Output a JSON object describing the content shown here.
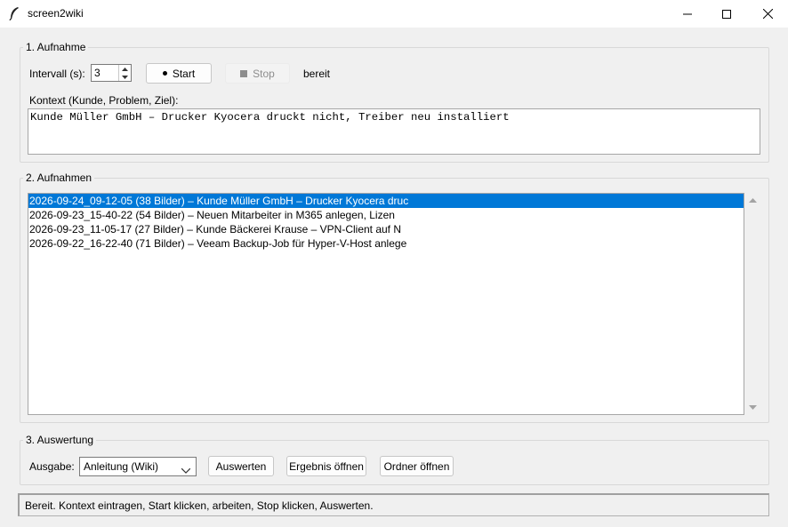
{
  "window": {
    "title": "screen2wiki"
  },
  "section1": {
    "label": "1. Aufnahme",
    "interval_label": "Intervall (s):",
    "interval_value": "3",
    "start_label": "Start",
    "stop_label": "Stop",
    "status": "bereit",
    "context_label": "Kontext (Kunde, Problem, Ziel):",
    "context_value": "Kunde Müller GmbH – Drucker Kyocera druckt nicht, Treiber neu installiert"
  },
  "section2": {
    "label": "2. Aufnahmen",
    "items": [
      "2026-09-24_09-12-05  (38 Bilder) – Kunde Müller GmbH – Drucker Kyocera druc",
      "2026-09-23_15-40-22  (54 Bilder) – Neuen Mitarbeiter in M365 anlegen, Lizen",
      "2026-09-23_11-05-17  (27 Bilder) – Kunde Bäckerei Krause – VPN-Client auf N",
      "2026-09-22_16-22-40  (71 Bilder) – Veeam Backup-Job für Hyper-V-Host anlege"
    ],
    "selected_index": 0
  },
  "section3": {
    "label": "3. Auswertung",
    "output_label": "Ausgabe:",
    "output_value": "Anleitung (Wiki)",
    "evaluate_label": "Auswerten",
    "open_result_label": "Ergebnis öffnen",
    "open_folder_label": "Ordner öffnen"
  },
  "statusbar": {
    "text": "Bereit. Kontext eintragen, Start klicken, arbeiten, Stop klicken, Auswerten."
  },
  "colors": {
    "selection": "#0078d7",
    "background": "#f0f0f0"
  }
}
